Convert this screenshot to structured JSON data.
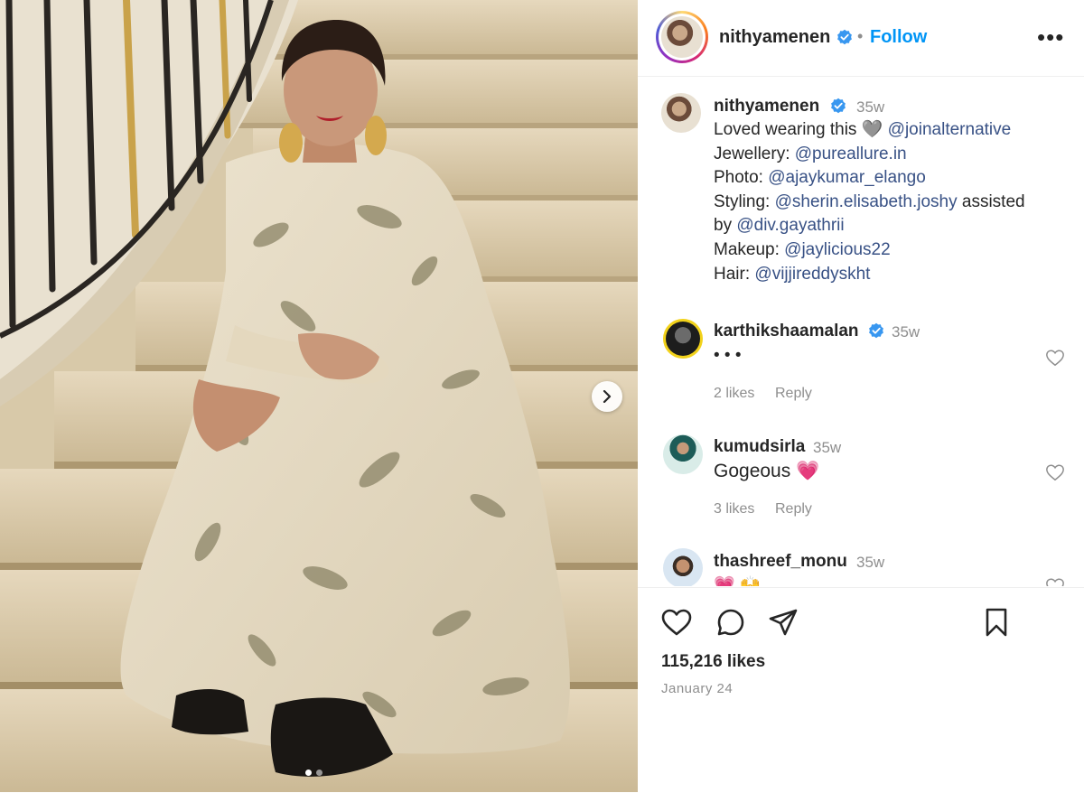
{
  "header": {
    "username": "nithyamenen",
    "separator": "•",
    "follow_label": "Follow",
    "more_label": "•••"
  },
  "caption": {
    "username": "nithyamenen",
    "time": "35w",
    "lines": [
      {
        "prefix": "Loved wearing this ",
        "emoji": "🩶",
        "mention": "@joinalternative",
        "suffix": ""
      },
      {
        "prefix": "Jewellery: ",
        "emoji": "",
        "mention": "@pureallure.in",
        "suffix": ""
      },
      {
        "prefix": "Photo: ",
        "emoji": "",
        "mention": "@ajaykumar_elango",
        "suffix": ""
      },
      {
        "prefix": "Styling: ",
        "emoji": "",
        "mention": "@sherin.elisabeth.joshy",
        "suffix": " assisted"
      },
      {
        "prefix": "by ",
        "emoji": "",
        "mention": "@div.gayathrii",
        "suffix": ""
      },
      {
        "prefix": "Makeup: ",
        "emoji": "",
        "mention": "@jaylicious22",
        "suffix": ""
      },
      {
        "prefix": "Hair: ",
        "emoji": "",
        "mention": "@vijjireddyskht",
        "suffix": ""
      }
    ]
  },
  "comments": [
    {
      "username": "karthikshaamalan",
      "verified": true,
      "time": "35w",
      "text": "•   •   •",
      "likes": "2 likes",
      "reply": "Reply"
    },
    {
      "username": "kumudsirla",
      "verified": false,
      "time": "35w",
      "text": "Gogeous 💗",
      "likes": "3 likes",
      "reply": "Reply"
    },
    {
      "username": "thashreef_monu",
      "verified": false,
      "time": "35w",
      "text": "💗 🙌",
      "likes": "",
      "reply": ""
    }
  ],
  "post": {
    "likes": "115,216 likes",
    "date": "January 24",
    "image_count": 2,
    "active_image": 1
  },
  "icons": {
    "like": "heart-icon",
    "comment": "comment-icon",
    "share": "share-icon",
    "save": "bookmark-icon",
    "next": "chevron-right-icon",
    "verified": "verified-badge-icon"
  },
  "colors": {
    "verified": "#3897f0",
    "link": "#385185",
    "follow": "#0095f6",
    "muted": "#8e8e8e"
  }
}
